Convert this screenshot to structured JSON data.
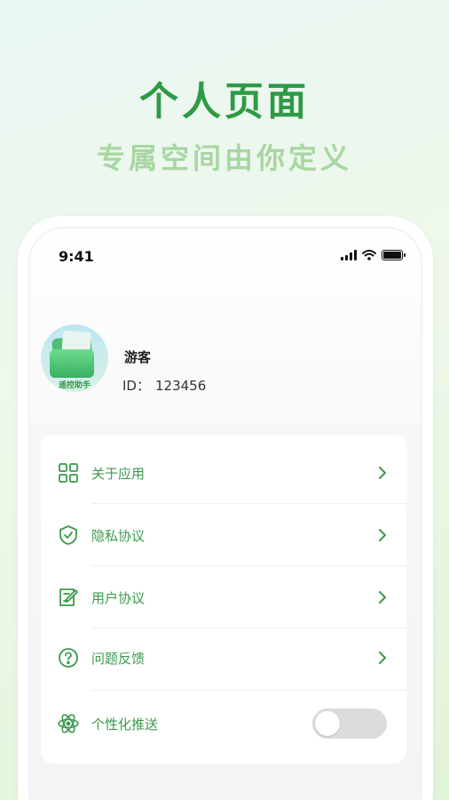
{
  "hero": {
    "title": "个人页面",
    "subtitle": "专属空间由你定义"
  },
  "status_bar": {
    "time": "9:41",
    "icons": [
      "signal-icon",
      "wifi-icon",
      "battery-icon"
    ]
  },
  "profile": {
    "avatar_text": "遥控助手",
    "name": "游客",
    "id_label": "ID：",
    "id_value": "123456"
  },
  "menu": {
    "items": [
      {
        "label": "关于应用",
        "icon": "grid-icon",
        "control": "chevron-right-icon"
      },
      {
        "label": "隐私协议",
        "icon": "shield-check-icon",
        "control": "chevron-right-icon"
      },
      {
        "label": "用户协议",
        "icon": "document-edit-icon",
        "control": "chevron-right-icon"
      },
      {
        "label": "问题反馈",
        "icon": "question-circle-icon",
        "control": "chevron-right-icon"
      },
      {
        "label": "个性化推送",
        "icon": "atom-icon",
        "control": "toggle",
        "toggle_on": false
      }
    ]
  },
  "colors": {
    "accent": "#3b9a4c",
    "title": "#2f9a46",
    "subtitle": "#a9d6a2",
    "toggle_off": "#dcdcdc"
  }
}
